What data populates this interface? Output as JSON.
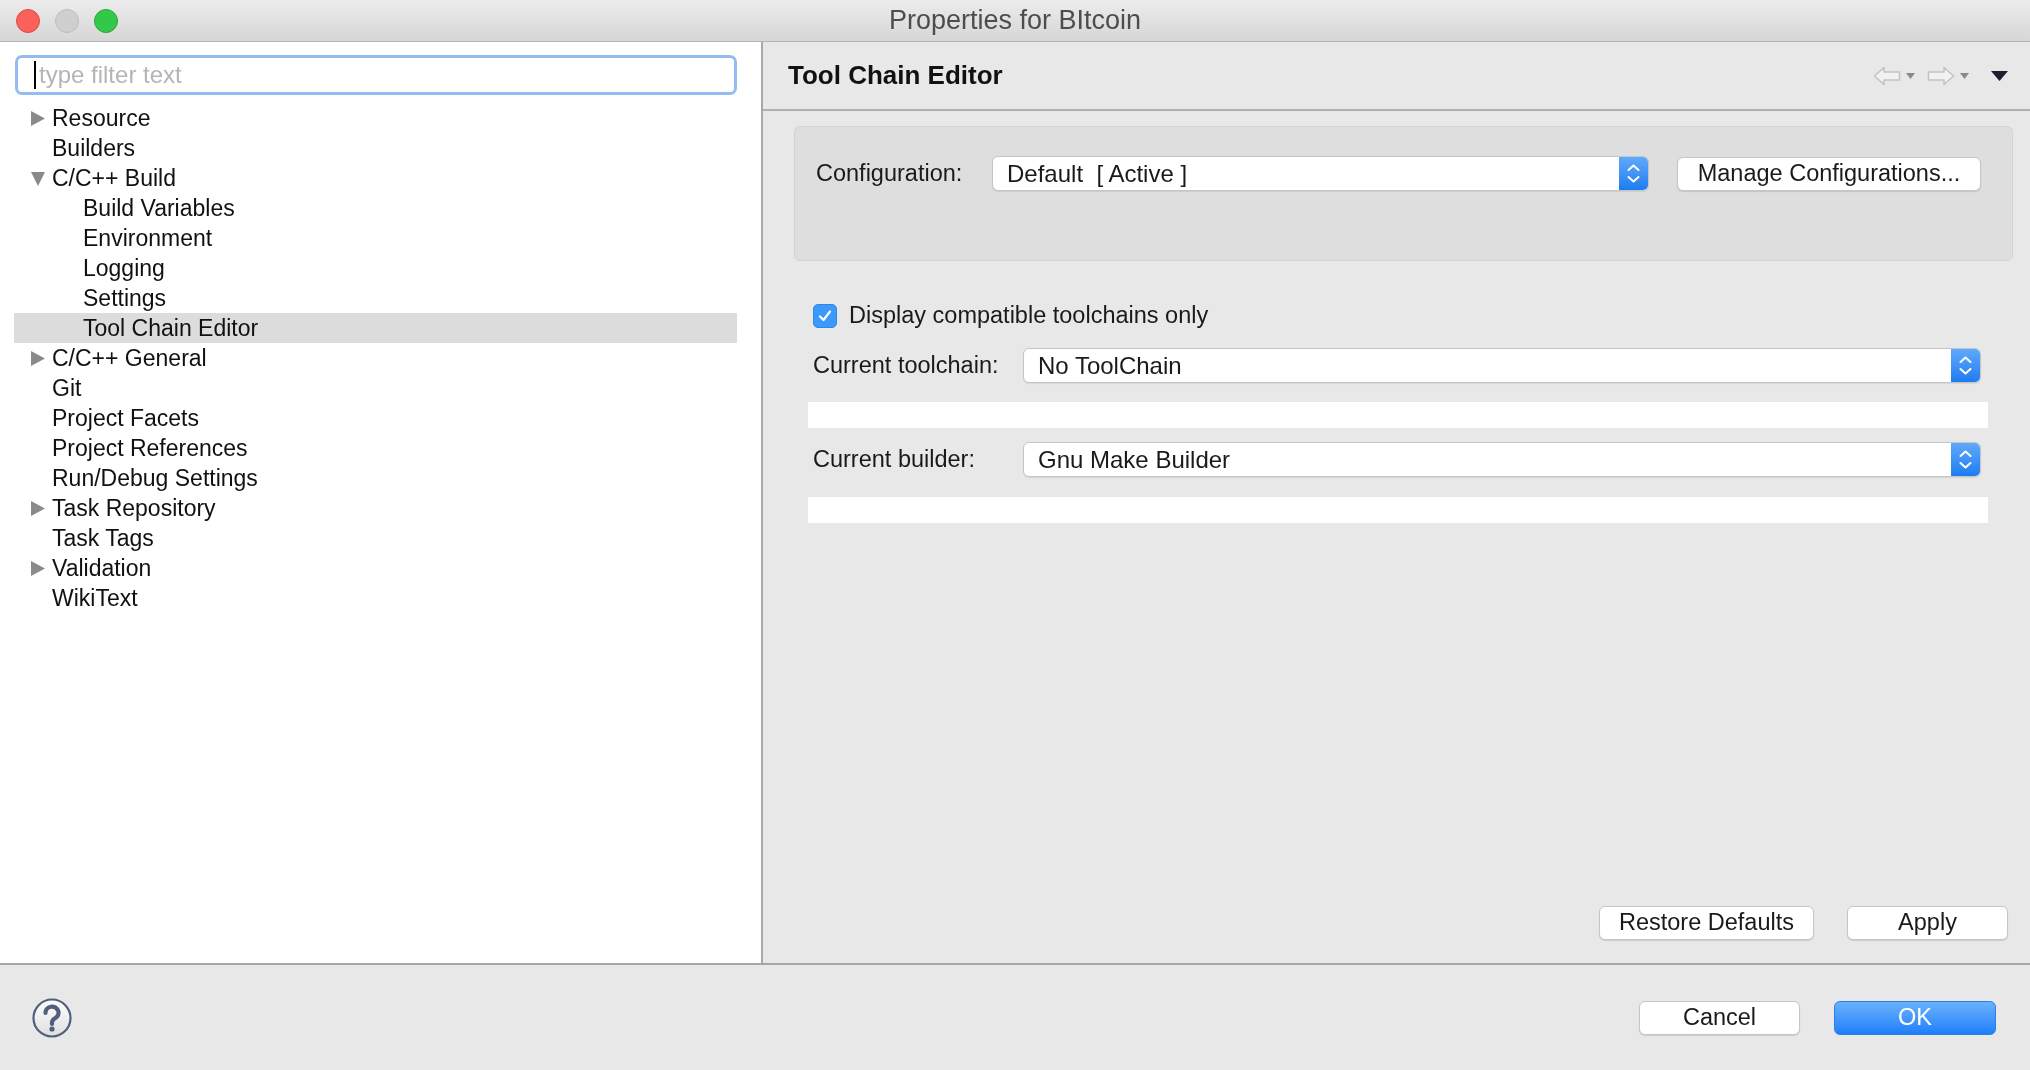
{
  "window": {
    "title": "Properties for BItcoin"
  },
  "filter": {
    "placeholder": "type filter text"
  },
  "tree": [
    {
      "label": "Resource",
      "kind": "group",
      "expanded": false,
      "selected": false
    },
    {
      "label": "Builders",
      "kind": "leaf",
      "selected": false
    },
    {
      "label": "C/C++ Build",
      "kind": "group",
      "expanded": true,
      "selected": false,
      "children": [
        {
          "label": "Build Variables",
          "kind": "leaf",
          "selected": false
        },
        {
          "label": "Environment",
          "kind": "leaf",
          "selected": false
        },
        {
          "label": "Logging",
          "kind": "leaf",
          "selected": false
        },
        {
          "label": "Settings",
          "kind": "leaf",
          "selected": false
        },
        {
          "label": "Tool Chain Editor",
          "kind": "leaf",
          "selected": true
        }
      ]
    },
    {
      "label": "C/C++ General",
      "kind": "group",
      "expanded": false,
      "selected": false
    },
    {
      "label": "Git",
      "kind": "leaf",
      "selected": false
    },
    {
      "label": "Project Facets",
      "kind": "leaf",
      "selected": false
    },
    {
      "label": "Project References",
      "kind": "leaf",
      "selected": false
    },
    {
      "label": "Run/Debug Settings",
      "kind": "leaf",
      "selected": false
    },
    {
      "label": "Task Repository",
      "kind": "group",
      "expanded": false,
      "selected": false
    },
    {
      "label": "Task Tags",
      "kind": "leaf",
      "selected": false
    },
    {
      "label": "Validation",
      "kind": "group",
      "expanded": false,
      "selected": false
    },
    {
      "label": "WikiText",
      "kind": "leaf",
      "selected": false
    }
  ],
  "page": {
    "title": "Tool Chain Editor",
    "configuration": {
      "label": "Configuration:",
      "value": "Default  [ Active ]",
      "button": "Manage Configurations..."
    },
    "compatible_only": {
      "label": "Display compatible toolchains only",
      "checked": true
    },
    "selectors": [
      {
        "label": "Current toolchain:",
        "value": "No ToolChain"
      },
      {
        "label": "Current builder:",
        "value": "Gnu Make Builder"
      }
    ],
    "buttons": [
      "Restore Defaults",
      "Apply"
    ]
  },
  "dialog_buttons": [
    {
      "label": "Cancel",
      "default": false
    },
    {
      "label": "OK",
      "default": true
    }
  ]
}
